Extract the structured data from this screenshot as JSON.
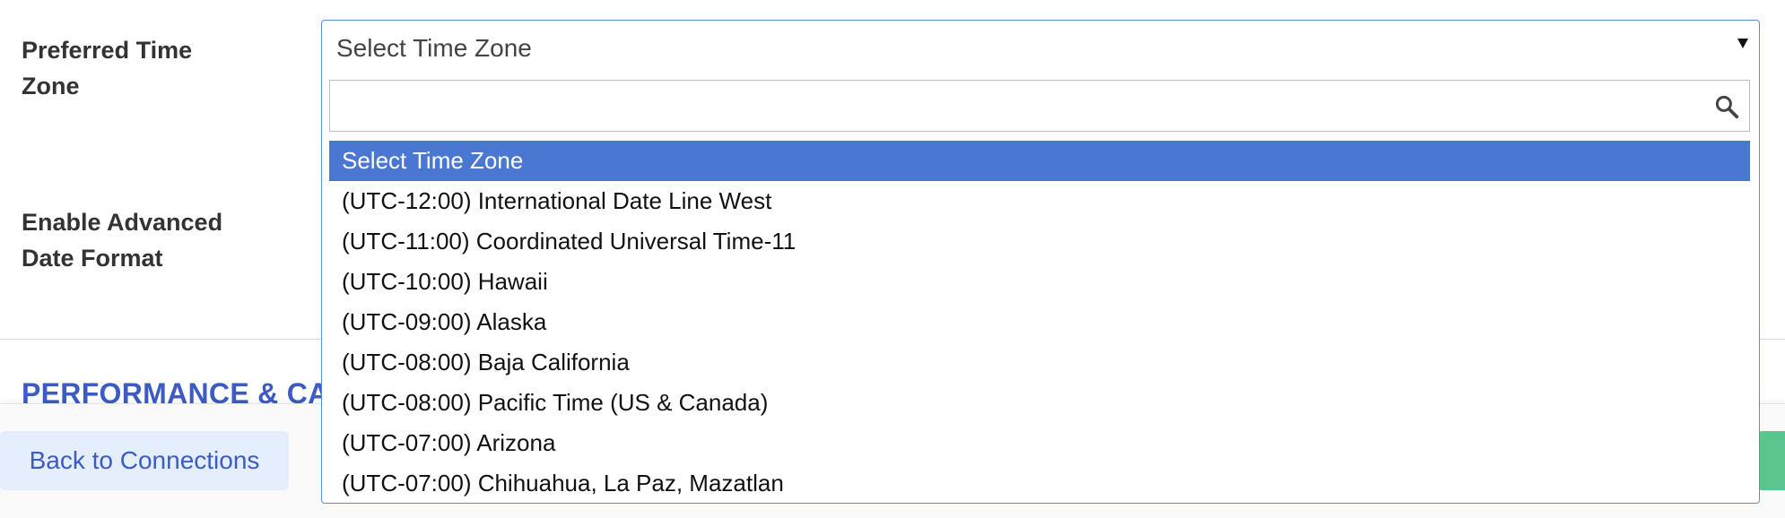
{
  "form": {
    "timezone_label": "Preferred Time Zone",
    "date_format_label": "Enable Advanced Date Format"
  },
  "section": {
    "title": "PERFORMANCE & CAC"
  },
  "footer": {
    "back_label": "Back to Connections"
  },
  "timezone_select": {
    "current_value": "Select Time Zone",
    "search_value": "",
    "search_placeholder": "",
    "options": [
      "Select Time Zone",
      "(UTC-12:00) International Date Line West",
      "(UTC-11:00) Coordinated Universal Time-11",
      "(UTC-10:00) Hawaii",
      "(UTC-09:00) Alaska",
      "(UTC-08:00) Baja California",
      "(UTC-08:00) Pacific Time (US & Canada)",
      "(UTC-07:00) Arizona",
      "(UTC-07:00) Chihuahua, La Paz, Mazatlan"
    ],
    "selected_index": 0
  },
  "colors": {
    "accent": "#3c5cc4",
    "highlight": "#4a77d1",
    "focus_border": "#5b8bd8",
    "save_button": "#5cc48f",
    "back_button_bg": "#e4eefc"
  },
  "icons": {
    "dropdown_caret": "caret-down-icon",
    "search": "search-icon"
  }
}
